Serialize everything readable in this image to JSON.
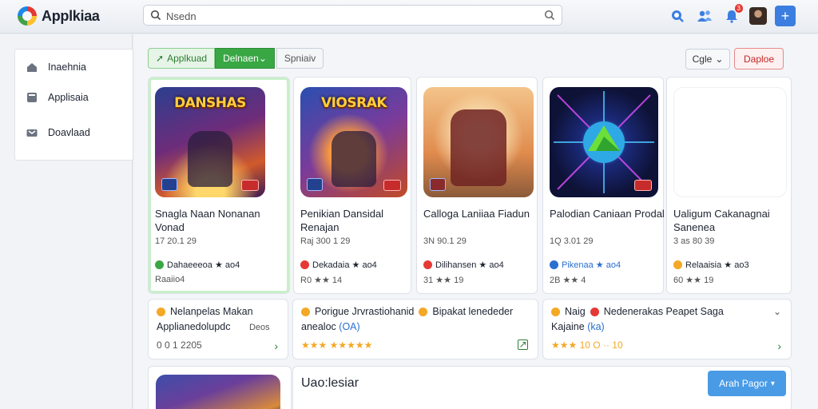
{
  "app": {
    "name": "Applkiaa"
  },
  "search": {
    "placeholder": "Nsedn"
  },
  "header": {
    "notification_count": "3"
  },
  "sidebar": {
    "items": [
      {
        "label": "Inaehnia",
        "icon": "home-icon"
      },
      {
        "label": "Applisaia",
        "icon": "apps-icon"
      },
      {
        "label": "Doavlaad",
        "icon": "download-icon"
      }
    ]
  },
  "filters": {
    "apps_label": "Applkuad",
    "selected_label": "Delnaen",
    "secondary_label": "Spniaiv"
  },
  "toolbar": {
    "sort_label": "Cgle",
    "deploy_label": "Daploe"
  },
  "cards": [
    {
      "thumb_text": "DANSHAS",
      "title": "Snagla Naan Nonanan Vonad",
      "meta": "17 20.1 29",
      "developer": "Dahaeeeoa ★ ao4",
      "rating": "Raaiio4",
      "dev_color": "#3aa745"
    },
    {
      "thumb_text": "VIOSRAK",
      "title": "Penikian Dansidal Renajan",
      "meta": "Raj 300 1 29",
      "developer": "Dekadaia ★ ao4",
      "rating": "R0 ★★ 14",
      "dev_color": "#e53935"
    },
    {
      "thumb_text": "",
      "title": "Calloga Laniiaa Fiadun",
      "meta": "3N 90.1 29",
      "developer": "Dilihansen ★ ao4",
      "rating": "31 ★★ 19",
      "dev_color": "#e53935"
    },
    {
      "thumb_text": "",
      "title": "Palodian Caniaan Prodal",
      "meta": "1Q 3.01 29",
      "developer": "Pikenaa ★ ao4",
      "rating": "2B ★★ 4",
      "dev_color": "#2a6fd1"
    },
    {
      "thumb_text": "",
      "title": "Ualigum Cakanagnai Sanenea",
      "meta": "3 as 80 39",
      "developer": "Relaaisia ★ ao3",
      "rating": "60 ★★ 19",
      "dev_color": "#f4a825"
    }
  ],
  "rows": [
    {
      "line1": "Nelanpelas Makan",
      "line2": "Applianedolupdc",
      "line2_right": "Deos",
      "line3": "0 0 1 2205"
    },
    {
      "line1": "Porigue Jrvrastiohanid",
      "line1b": "Bipakat lenededer",
      "line2": "anealoc",
      "line2_link": "(OA)",
      "line3": "★★★ ★★★★★"
    },
    {
      "line1": "Naig",
      "line1b": "Nedenerakas Peapet Saga",
      "line2": "Kajaine",
      "line2_link": "(ka)",
      "line3": "★★★ 10 O ·· 10"
    }
  ],
  "bottom": {
    "heading": "Uao:lesiar",
    "button_label": "Arah Pagor"
  },
  "colors": {
    "accent": "#3aa745",
    "primary": "#4a9be6",
    "danger": "#c62828"
  }
}
